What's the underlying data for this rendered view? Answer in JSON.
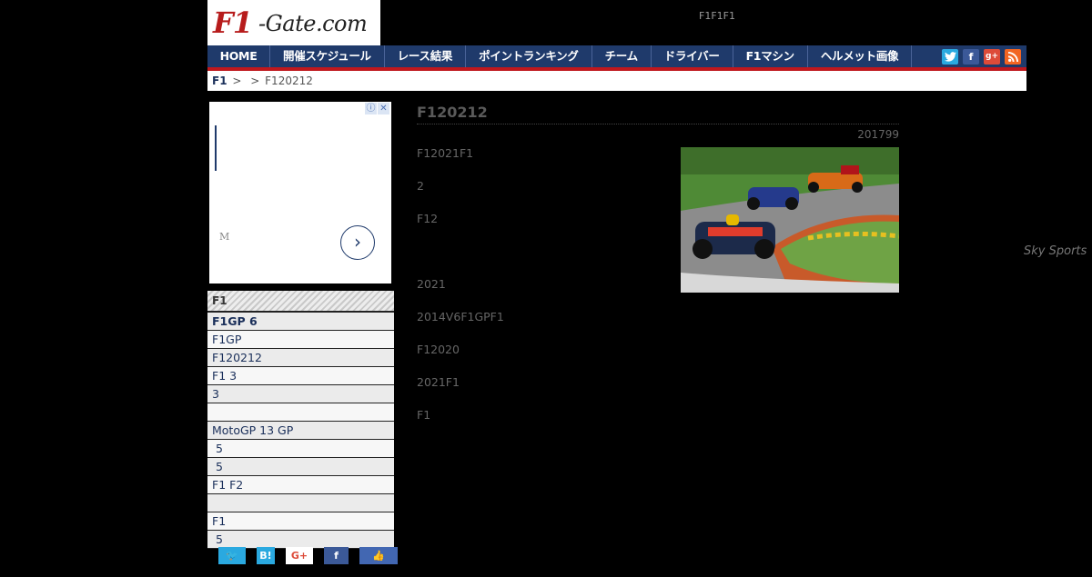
{
  "header": {
    "logo_f1": "F1",
    "logo_rest": "-Gate.com",
    "tagline": "F1F1F1"
  },
  "nav": {
    "items": [
      "HOME",
      "開催スケジュール",
      "レース結果",
      "ポイントランキング",
      "チーム",
      "ドライバー",
      "F1マシン",
      "ヘルメット画像"
    ]
  },
  "social": {
    "twitter": "t",
    "facebook": "f",
    "google": "g+",
    "rss": "rss"
  },
  "breadcrumb": {
    "home": "F1",
    "sep1": ">",
    "sep2": ">",
    "current": "F120212"
  },
  "ad": {
    "info_icon": "ⓘ",
    "close_icon": "✕",
    "m_text": "M",
    "next_icon": "›"
  },
  "sidebar": {
    "heading": "F1",
    "items": [
      "F1GP 6",
      "F1GP",
      "F120212",
      "F1 3",
      "3",
      "",
      "MotoGP 13 GP",
      " 5",
      " 5",
      "F1 F2",
      "",
      "F1",
      " 5"
    ],
    "heading2": "F1"
  },
  "article": {
    "title": "F120212",
    "date": "201799",
    "paragraphs": [
      "F12021F1",
      "2",
      "F12",
      "",
      "2021",
      "2014V6F1GPF1",
      "F12020",
      "2021F1",
      "F1"
    ],
    "photo_caption": "Sky Sports"
  },
  "share": {
    "twitter": "🐦",
    "hatena": "B!",
    "google": "G+",
    "facebook": "f",
    "like": "👍"
  },
  "colors": {
    "nav_bg": "#1f3a6b",
    "accent_red": "#c0181d",
    "background": "#000000"
  }
}
